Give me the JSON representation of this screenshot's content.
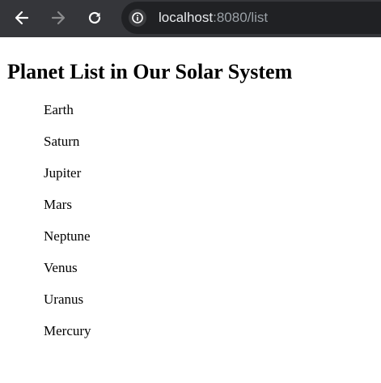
{
  "browser": {
    "url_host": "localhost",
    "url_rest": ":8080/list"
  },
  "page": {
    "title": "Planet List in Our Solar System",
    "planets": [
      "Earth",
      "Saturn",
      "Jupiter",
      "Mars",
      "Neptune",
      "Venus",
      "Uranus",
      "Mercury"
    ]
  }
}
